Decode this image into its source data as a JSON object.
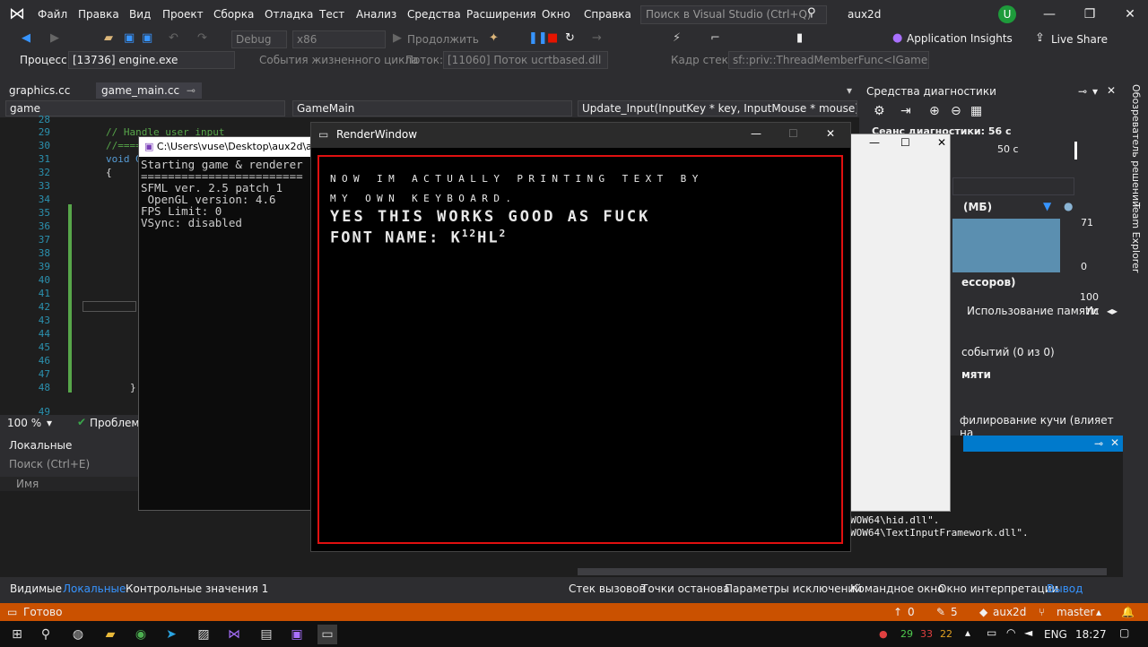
{
  "menu": [
    "Файл",
    "Правка",
    "Вид",
    "Проект",
    "Сборка",
    "Отладка",
    "Тест",
    "Анализ",
    "Средства",
    "Расширения",
    "Окно",
    "Справка"
  ],
  "search_placeholder": "Поиск в Visual Studio (Ctrl+Q)",
  "solution_name": "aux2d",
  "avatar_letter": "U",
  "toolbar": {
    "config": "Debug",
    "platform": "x86",
    "continue": "Продолжить",
    "app_insights": "Application Insights",
    "live_share": "Live Share"
  },
  "process_bar": {
    "process_label": "Процесс:",
    "process_value": "[13736] engine.exe",
    "lifecycle": "События жизненного цикла",
    "thread_label": "Поток:",
    "thread_value": "[11060] Поток ucrtbased.dll",
    "frame_label": "Кадр стека:",
    "frame_value": "sf::priv::ThreadMemberFunc<IGame>::rur"
  },
  "tabs": [
    "graphics.cc",
    "game_main.cc"
  ],
  "nav": {
    "project": "game",
    "scope": "GameMain",
    "member": "Update_Input(InputKey * key, InputMouse * mouse)"
  },
  "lines": [
    "28",
    "29",
    "30",
    "31",
    "32",
    "33",
    "34",
    "35",
    "36",
    "37",
    "38",
    "39",
    "40",
    "41",
    "42",
    "43",
    "44",
    "45",
    "46",
    "47",
    "48",
    "49"
  ],
  "code": {
    "c29": "//  Handle user input",
    "c30": "//====",
    "c31": "void G",
    "c32": "{",
    "c47": "}"
  },
  "zoom": "100 %",
  "problems": "Проблемы",
  "locals": {
    "title": "Локальные",
    "search": "Поиск (Ctrl+E)",
    "col_name": "Имя"
  },
  "bottom_tabs_left": [
    "Видимые",
    "Локальные",
    "Контрольные значения 1"
  ],
  "bottom_tabs_right": [
    "Стек вызовов",
    "Точки останова",
    "Параметры исключений",
    "Командное окно",
    "Окно интерпретации",
    "Вывод"
  ],
  "diag": {
    "title": "Средства диагностики",
    "session": "Сеанс диагностики: 56 с",
    "tick": "50 с",
    "mem": "(МБ)",
    "mem_max": "71",
    "mem_min": "0",
    "cpu": "ессоров)",
    "cpu_max": "100",
    "tab_mem": "Использование памяти",
    "tab_other": "Ис",
    "events": "событий (0 из 0)",
    "memory": "мяти",
    "heap": "филирование кучи (влияет на"
  },
  "sidebar_right": [
    "Обозреватель решений",
    "Team Explorer"
  ],
  "output": [
    "WOW64\\hid.dll\".",
    "WOW64\\TextInputFramework.dll\"."
  ],
  "status": {
    "ready": "Готово",
    "up": "0",
    "pencil": "5",
    "repo": "aux2d",
    "branch": "master"
  },
  "console": {
    "title": "C:\\Users\\vuse\\Desktop\\aux2d\\au",
    "text": "Starting game & renderer\n========================\nSFML ver. 2.5 patch 1\n OpenGL version: 4.6\nFPS Limit: 0\nVSync: disabled"
  },
  "render": {
    "title": "RenderWindow",
    "line1": "NOW IM ACTUALLY PRINTING TEXT BY",
    "line2": "MY OWN KEYBOARD.",
    "line3": "YES THIS WORKS GOOD AS FUCK",
    "line4a": "FONT NAME: K",
    "sup1": "12",
    "line4b": "HL",
    "sup2": "2"
  },
  "taskbar": {
    "lang": "ENG",
    "time": "18:27",
    "n1": "29",
    "n2": "33",
    "n3": "22"
  }
}
